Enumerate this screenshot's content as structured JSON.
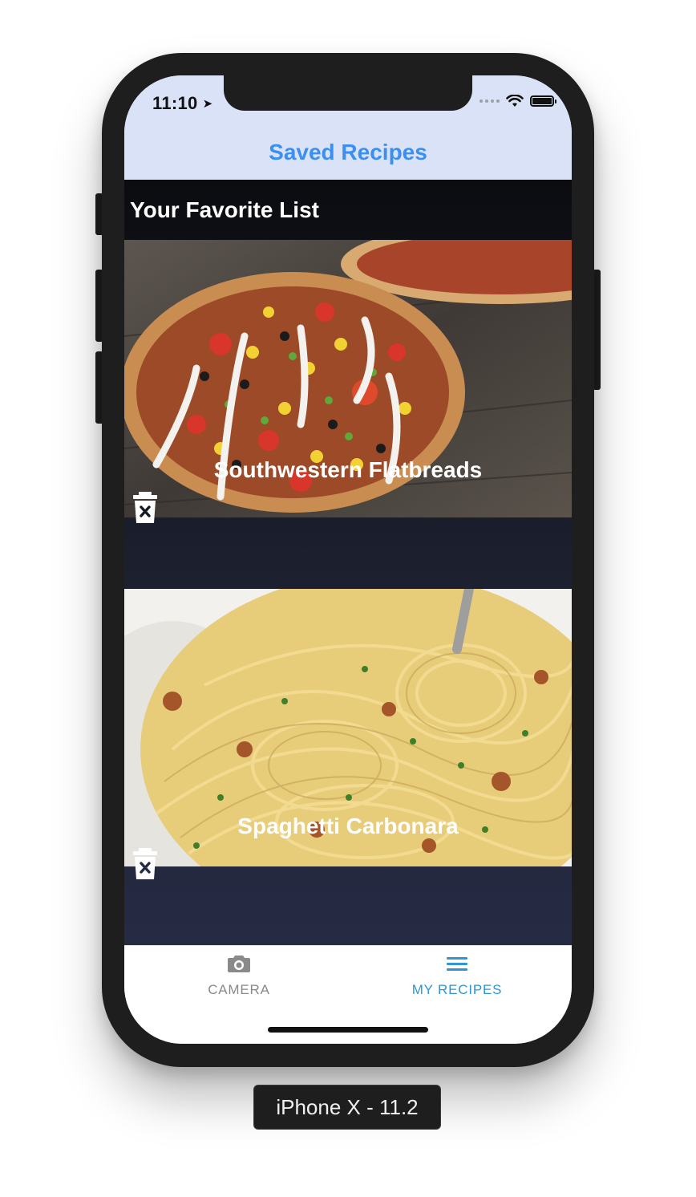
{
  "device": {
    "label": "iPhone X - 11.2"
  },
  "status_bar": {
    "time": "11:10",
    "location_icon": "location-arrow-icon",
    "wifi_icon": "wifi-icon",
    "battery_icon": "battery-icon"
  },
  "nav": {
    "title": "Saved Recipes",
    "title_color": "#3a8ff0",
    "background": "#d9e2f7"
  },
  "favorites": {
    "heading": "Your Favorite List",
    "recipes": [
      {
        "title": "Southwestern Flatbreads",
        "image": "flatbread-photo",
        "delete_icon": "trash-x-icon"
      },
      {
        "title": "Spaghetti Carbonara",
        "image": "spaghetti-photo",
        "delete_icon": "trash-x-icon"
      }
    ]
  },
  "tabbar": {
    "tabs": [
      {
        "label": "CAMERA",
        "icon": "camera-icon",
        "active": false
      },
      {
        "label": "MY RECIPES",
        "icon": "menu-icon",
        "active": true
      }
    ],
    "active_color": "#2f95d6",
    "inactive_color": "#8a8a8a"
  }
}
